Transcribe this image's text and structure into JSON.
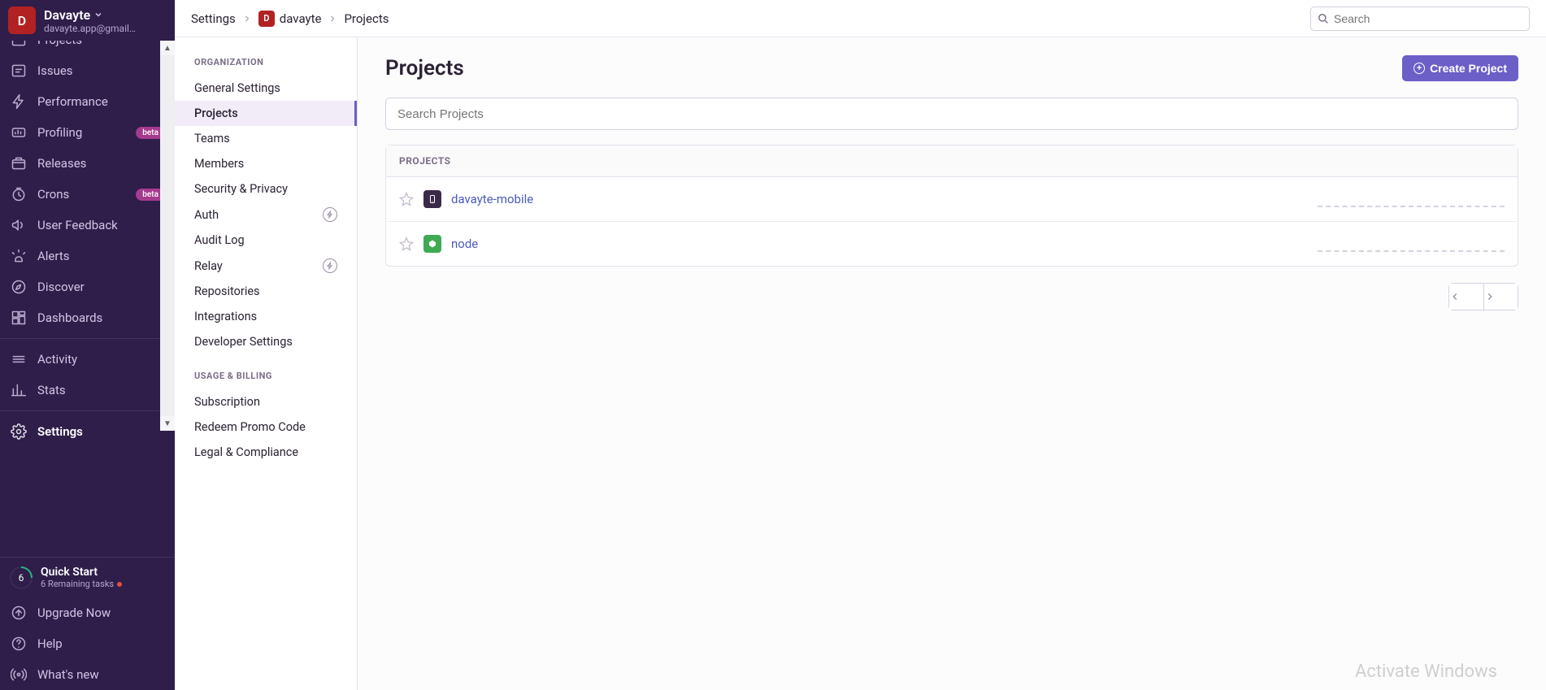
{
  "org": {
    "name": "Davayte",
    "email": "davayte.app@gmail…",
    "avatar_letter": "D"
  },
  "left_nav": [
    {
      "key": "projects",
      "label": "Projects",
      "icon": "projects-icon"
    },
    {
      "key": "issues",
      "label": "Issues",
      "icon": "issues-icon"
    },
    {
      "key": "performance",
      "label": "Performance",
      "icon": "bolt-icon"
    },
    {
      "key": "profiling",
      "label": "Profiling",
      "icon": "profiling-icon",
      "badge": "beta"
    },
    {
      "key": "releases",
      "label": "Releases",
      "icon": "releases-icon"
    },
    {
      "key": "crons",
      "label": "Crons",
      "icon": "clock-icon",
      "badge": "beta"
    },
    {
      "key": "userfeedback",
      "label": "User Feedback",
      "icon": "megaphone-icon"
    },
    {
      "key": "alerts",
      "label": "Alerts",
      "icon": "siren-icon"
    },
    {
      "key": "discover",
      "label": "Discover",
      "icon": "discover-icon"
    },
    {
      "key": "dashboards",
      "label": "Dashboards",
      "icon": "dashboards-icon"
    },
    {
      "key": "activity",
      "label": "Activity",
      "icon": "activity-icon"
    },
    {
      "key": "stats",
      "label": "Stats",
      "icon": "stats-icon"
    },
    {
      "key": "settings",
      "label": "Settings",
      "icon": "gear-icon",
      "active": true
    }
  ],
  "quick_start": {
    "title": "Quick Start",
    "subtitle": "6 Remaining tasks",
    "count": "6"
  },
  "footer_nav": [
    {
      "key": "upgrade",
      "label": "Upgrade Now",
      "icon": "upgrade-icon"
    },
    {
      "key": "help",
      "label": "Help",
      "icon": "help-icon"
    },
    {
      "key": "whatsnew",
      "label": "What's new",
      "icon": "broadcast-icon"
    }
  ],
  "breadcrumbs": {
    "root": "Settings",
    "org": "davayte",
    "page": "Projects",
    "avatar_letter": "D"
  },
  "search": {
    "placeholder": "Search"
  },
  "settings_nav": {
    "organization_title": "ORGANIZATION",
    "organization": [
      {
        "key": "general",
        "label": "General Settings"
      },
      {
        "key": "projects",
        "label": "Projects",
        "active": true
      },
      {
        "key": "teams",
        "label": "Teams"
      },
      {
        "key": "members",
        "label": "Members"
      },
      {
        "key": "security",
        "label": "Security & Privacy"
      },
      {
        "key": "auth",
        "label": "Auth",
        "power": true
      },
      {
        "key": "audit",
        "label": "Audit Log"
      },
      {
        "key": "relay",
        "label": "Relay",
        "power": true
      },
      {
        "key": "repos",
        "label": "Repositories"
      },
      {
        "key": "integrations",
        "label": "Integrations"
      },
      {
        "key": "devsettings",
        "label": "Developer Settings"
      }
    ],
    "billing_title": "USAGE & BILLING",
    "billing": [
      {
        "key": "subscription",
        "label": "Subscription"
      },
      {
        "key": "promo",
        "label": "Redeem Promo Code"
      },
      {
        "key": "legal",
        "label": "Legal & Compliance"
      }
    ]
  },
  "pane": {
    "title": "Projects",
    "create_button": "Create Project",
    "search_placeholder": "Search Projects",
    "list_header": "PROJECTS",
    "projects": [
      {
        "name": "davayte-mobile",
        "icon": "mobile",
        "color": "dark"
      },
      {
        "name": "node",
        "icon": "node",
        "color": "green"
      }
    ]
  },
  "watermark": "Activate Windows"
}
